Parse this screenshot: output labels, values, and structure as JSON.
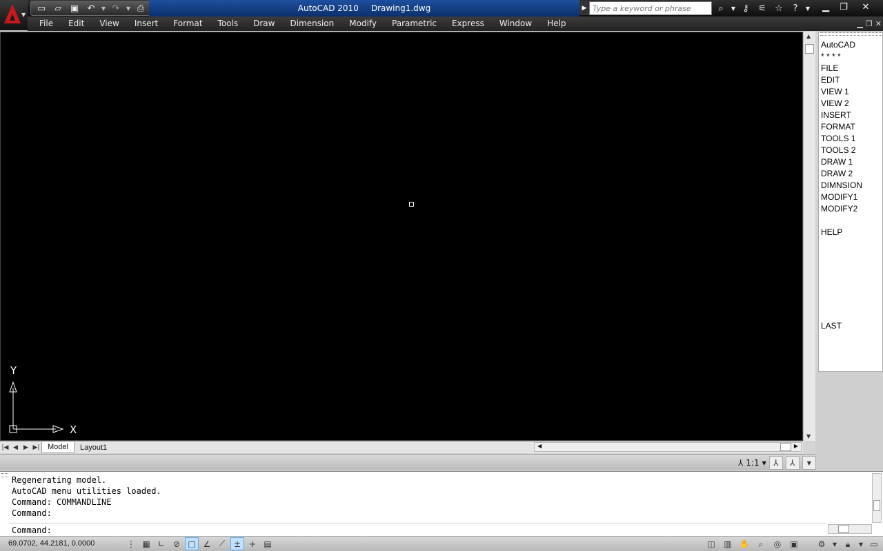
{
  "title": {
    "app": "AutoCAD 2010",
    "document": "Drawing1.dwg"
  },
  "search": {
    "placeholder": "Type a keyword or phrase"
  },
  "menu": [
    "File",
    "Edit",
    "View",
    "Insert",
    "Format",
    "Tools",
    "Draw",
    "Dimension",
    "Modify",
    "Parametric",
    "Express",
    "Window",
    "Help"
  ],
  "screen_menu": {
    "items": [
      "AutoCAD",
      "* * * *",
      "FILE",
      "EDIT",
      "VIEW 1",
      "VIEW 2",
      "INSERT",
      "FORMAT",
      "TOOLS 1",
      "TOOLS 2",
      "DRAW 1",
      "DRAW 2",
      "DIMNSION",
      "MODIFY1",
      "MODIFY2",
      "",
      "HELP"
    ],
    "last": "LAST"
  },
  "ucs": {
    "x_label": "X",
    "y_label": "Y"
  },
  "layout_tabs": [
    "Model",
    "Layout1"
  ],
  "annotation": {
    "scale": "1:1"
  },
  "command": {
    "history": [
      "Regenerating model.",
      "AutoCAD menu utilities loaded.",
      "Command: COMMANDLINE",
      "Command:"
    ],
    "prompt": "Command:"
  },
  "status": {
    "coordinates": "69.0702, 44.2181, 0.0000"
  },
  "colors": {
    "canvas_bg": "#000000",
    "title_accent": "#1e4f9e",
    "logo_red": "#c8181b"
  }
}
